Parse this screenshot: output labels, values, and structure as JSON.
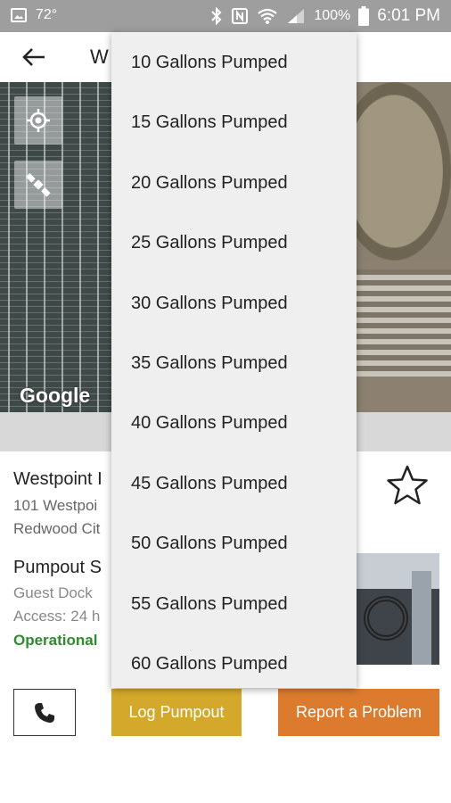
{
  "status_bar": {
    "temperature": "72°",
    "battery": "100%",
    "time": "6:01 PM"
  },
  "app_bar": {
    "title": "W"
  },
  "map": {
    "logo": "Google"
  },
  "details": {
    "marina_name": "Westpoint I",
    "address_line1": "101 Westpoi",
    "address_line2": "Redwood Cit",
    "pumpout_title": "Pumpout S",
    "location": "Guest Dock",
    "access": "Access: 24 h",
    "status": "Operational",
    "status_color": "#2e8b2e"
  },
  "actions": {
    "log_pumpout": "Log Pumpout",
    "report_problem": "Report a Problem",
    "log_color": "#d4a92b",
    "report_color": "#dc7a2e"
  },
  "dropdown": {
    "options": [
      "10 Gallons Pumped",
      "15 Gallons Pumped",
      "20 Gallons Pumped",
      "25 Gallons Pumped",
      "30 Gallons Pumped",
      "35 Gallons Pumped",
      "40 Gallons Pumped",
      "45 Gallons Pumped",
      "50 Gallons Pumped",
      "55 Gallons Pumped",
      "60 Gallons Pumped"
    ]
  }
}
